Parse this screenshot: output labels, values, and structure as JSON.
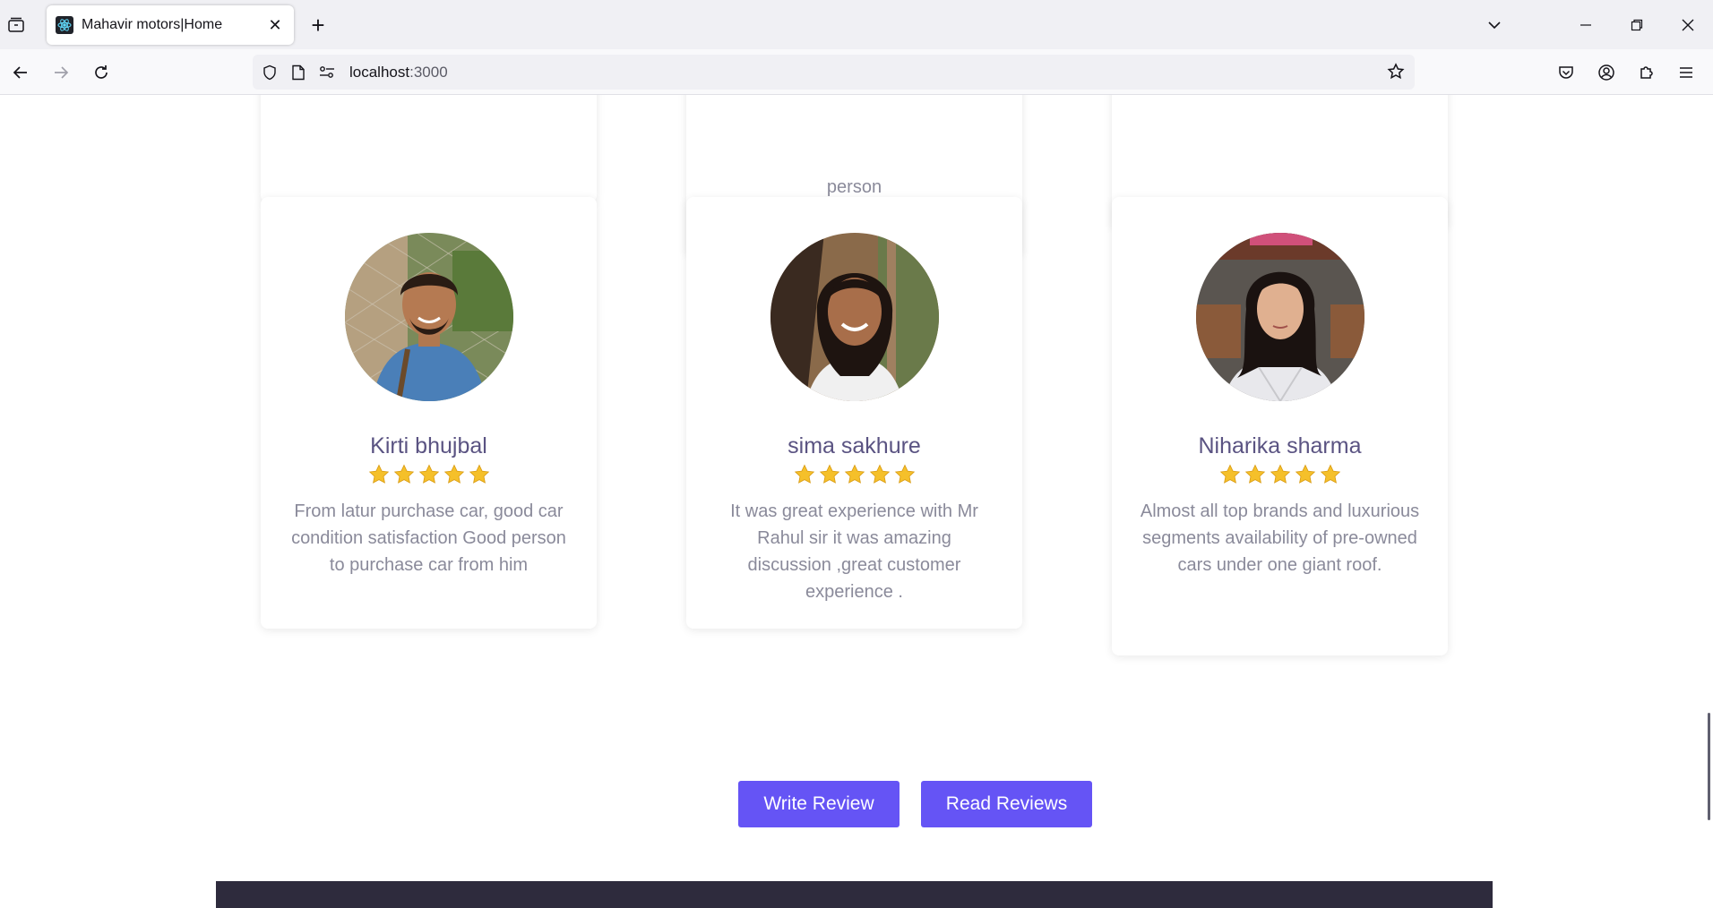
{
  "browser": {
    "tab_title": "Mahavir motors|Home",
    "url_host": "localhost",
    "url_port": ":3000"
  },
  "top_cards": {
    "middle_partial_text": "person"
  },
  "reviews": [
    {
      "name": "Kirti bhujbal",
      "rating": 5,
      "text": "From latur purchase car, good car condition satisfaction Good person to purchase car from him"
    },
    {
      "name": "sima sakhure",
      "rating": 5,
      "text": "It was great experience with Mr Rahul sir it was amazing discussion ,great customer experience ."
    },
    {
      "name": "Niharika sharma",
      "rating": 5,
      "text": "Almost all top brands and luxurious segments availability of pre-owned cars under one giant roof."
    }
  ],
  "actions": {
    "write_review": "Write Review",
    "read_reviews": "Read Reviews"
  },
  "colors": {
    "accent": "#6554f5",
    "name_text": "#5a5382",
    "star": "#f5c02a",
    "footer": "#2e2b3d"
  }
}
